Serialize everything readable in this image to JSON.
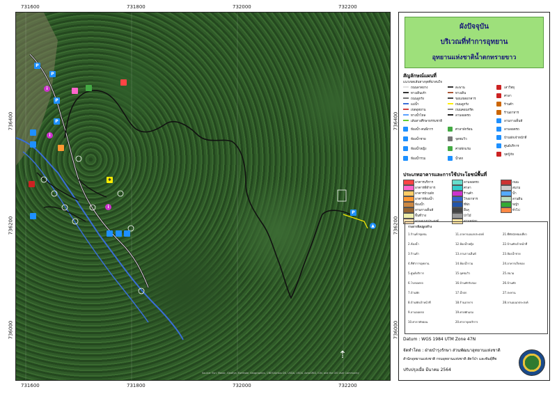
{
  "map": {
    "x_ticks": [
      "731600",
      "731800",
      "732000",
      "732200"
    ],
    "y_ticks": [
      "736400",
      "736200",
      "736000"
    ],
    "credits": "Source: Esri, Maxar, GeoEye, Earthstar Geographics, CNES/Airbus DS, USDA, USGS, AeroGRID, IGN, and the GIS User Community"
  },
  "title": {
    "line1": "ผังปัจจุบัน",
    "line2": "บริเวณที่ทำการอุทยาน",
    "line3": "อุทยานแห่งชาติน้ำตกทรายขาว"
  },
  "legend": {
    "heading": "สัญลักษณ์แผนที่",
    "sub": "แนวเขตเส้นทางจุดที่น่าสนใจ",
    "lines": [
      {
        "label": "ถนนลาดยาง",
        "color": "#e0e0e0"
      },
      {
        "label": "ทางเดินเท้า",
        "color": "#333333"
      },
      {
        "label": "ถนนลูกรัง",
        "color": "#777777"
      },
      {
        "label": "แม่น้ำ",
        "color": "#3a6ed8"
      },
      {
        "label": "เขตอุทยาน",
        "color": "#d04040"
      },
      {
        "label": "ทางน้ำไหล",
        "color": "#5aa0ff"
      },
      {
        "label": "เส้นทางศึกษาธรรมชาติ",
        "color": "#66cc33"
      }
    ],
    "lines2": [
      {
        "label": "สะพาน",
        "color": "#333333"
      },
      {
        "label": "ทางเดิน",
        "color": "#aa5533"
      },
      {
        "label": "ขอบเขตอาคาร",
        "color": "#444444"
      },
      {
        "label": "ถนนลูกรัง",
        "color": "#ffee00"
      },
      {
        "label": "ถนนคอนกรีต",
        "color": "#888888"
      },
      {
        "label": "ลานจอดรถ",
        "color": "#222222"
      }
    ],
    "icons": [
      {
        "label": "ห้องน้ำ-คนพิการ",
        "color": "#1e90ff"
      },
      {
        "label": "ห้องน้ำชาย",
        "color": "#1e90ff"
      },
      {
        "label": "ห้องน้ำหญิง",
        "color": "#1e90ff"
      },
      {
        "label": "ห้องน้ำรวม",
        "color": "#1e90ff"
      }
    ],
    "icons2": [
      {
        "label": "ศาลาพักร้อน",
        "color": "#44aa44"
      },
      {
        "label": "จุดชมวิว",
        "color": "#777777"
      },
      {
        "label": "ค่ายพักแรม",
        "color": "#44aa44"
      },
      {
        "label": "น้ำตก",
        "color": "#1e90ff"
      }
    ],
    "icons3": [
      {
        "label": "เสาวิทยุ",
        "color": "#cc2222"
      },
      {
        "label": "ศาลา",
        "color": "#cc2222"
      },
      {
        "label": "ร้านค้า",
        "color": "#cc6600"
      },
      {
        "label": "ร้านอาหาร",
        "color": "#cc6600"
      },
      {
        "label": "ลานกางเต็นท์",
        "color": "#1e90ff"
      },
      {
        "label": "ลานจอดรถ",
        "color": "#1e90ff"
      },
      {
        "label": "บ้านพักเจ้าหน้าที่",
        "color": "#1e90ff"
      },
      {
        "label": "ศูนย์บริการ",
        "color": "#1e90ff"
      },
      {
        "label": "จุดกู้ภัย",
        "color": "#cc2222"
      }
    ],
    "landuse_heading": "ประเภทอาคารและการใช้ประโยชน์พื้นที่",
    "landuse": [
      {
        "label": "อาคารบริการ",
        "color": "#ff4444"
      },
      {
        "label": "อาคารที่ทำการ",
        "color": "#ff66cc"
      },
      {
        "label": "อาคารบ้านพัก",
        "color": "#ffcc66"
      },
      {
        "label": "อาคารห้องน้ำ",
        "color": "#ff9933"
      },
      {
        "label": "ห้องน้ำ",
        "color": "#cc8844"
      },
      {
        "label": "ลานกางเต็นท์",
        "color": "#996633"
      },
      {
        "label": "พื้นที่ว่าง",
        "color": "#eeeeaa"
      },
      {
        "label": "ลานอเนกประสงค์",
        "color": "#ffe0b0"
      },
      {
        "label": "ลานจอดรถ",
        "color": "#66ddcc"
      },
      {
        "label": "ศาลา",
        "color": "#33cccc"
      },
      {
        "label": "ร้านค้า",
        "color": "#cc33cc"
      },
      {
        "label": "โรงอาหาร",
        "color": "#3366cc"
      },
      {
        "label": "ที่พัก",
        "color": "#2255aa"
      },
      {
        "label": "อื่นๆ",
        "color": "#444444"
      },
      {
        "label": "ป่าไม้",
        "color": "#999999"
      },
      {
        "label": "สวนหย่อม",
        "color": "#ffe4a0"
      },
      {
        "label": "ถนน",
        "color": "#cc3333"
      },
      {
        "label": "สนาม",
        "color": "#cccccc"
      },
      {
        "label": "น้ำ",
        "color": "#55aaff"
      },
      {
        "label": "ลานดิน",
        "color": "#bbddbb"
      },
      {
        "label": "หญ้า",
        "color": "#33aa33"
      },
      {
        "label": "ทั่วไป",
        "color": "#ff8844"
      }
    ],
    "list_heading": "รายการสิ่งปลูกสร้าง",
    "list": [
      "1.ร้านค้าชุมชน",
      "2.ห้องน้ำ",
      "3.ร้านค้า",
      "4.ที่ทำการอุทยาน",
      "5.ศูนย์บริการ",
      "6.โรงจอดรถ",
      "7.บ้านพัก",
      "8.บ้านพักเจ้าหน้าที่",
      "9.ลานจอดรถ",
      "10.ศาลาพักผ่อน",
      "11.อาคารเอนกประสงค์",
      "12.ห้องน้ำหญิง",
      "13.ลานกางเต็นท์",
      "14.ห้องน้ำรวม",
      "15.จุดชมวิว",
      "16.บ้านพักรับรอง",
      "17.น้ำตก",
      "18.ร้านอาหาร",
      "19.ค่ายพักแรม",
      "20.ศาลาจุดบริการ",
      "21.ที่พักนักท่องเที่ยว",
      "22.บ้านพักเจ้าหน้าที่",
      "23.ห้องน้ำชาย",
      "24.อาคารเก็บของ",
      "25.สนาม",
      "26.บ้านพัก",
      "27.สะพาน",
      "28.ลานอเนกประสงค์"
    ]
  },
  "footer": {
    "datum": "Datum  :  WGS 1984 UTM Zone 47N",
    "made_by": "จัดทำโดย   :  ฝ่ายบำรุงรักษา ส่วนพัฒนาอุทยานแห่งชาติ",
    "office": "สำนักอุทยานแห่งชาติ  กรมอุทยานแห่งชาติ สัตว์ป่า และพันธุ์พืช",
    "updated": "ปรับปรุงเมื่อ มีนาคม 2564"
  }
}
